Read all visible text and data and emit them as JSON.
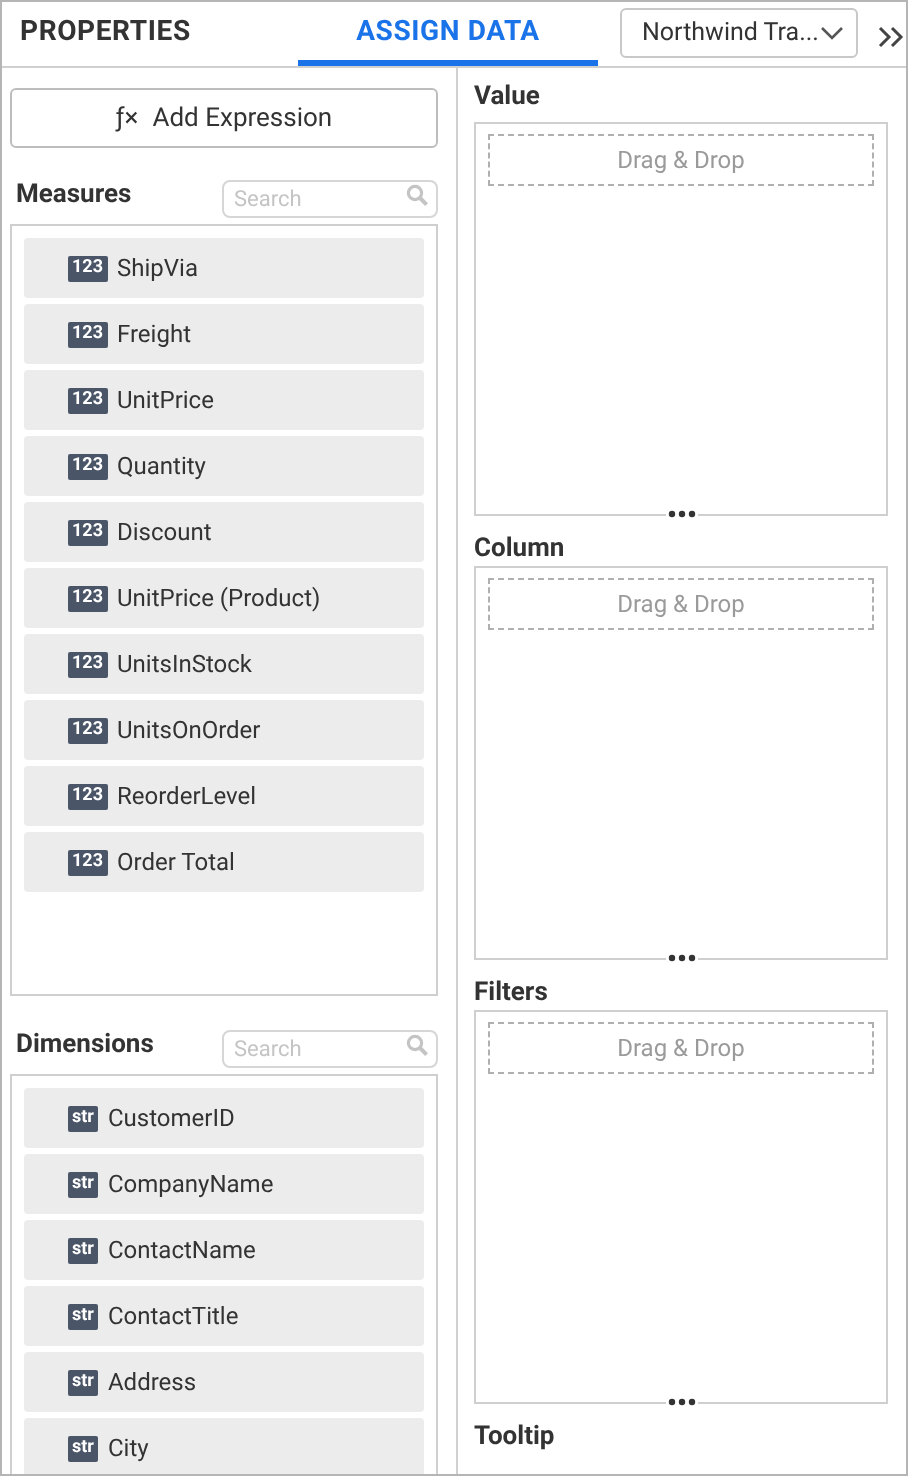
{
  "tabs": [
    {
      "label": "PROPERTIES",
      "selected": false
    },
    {
      "label": "ASSIGN DATA",
      "selected": true
    }
  ],
  "datasource": {
    "value": "Northwind Tra..."
  },
  "add_expression": {
    "icon": "ƒ×",
    "label": "Add Expression"
  },
  "sections": [
    {
      "title": "Measures",
      "search": {
        "placeholder": "Search"
      },
      "items": [
        {
          "type": "123",
          "label": "ShipVia"
        },
        {
          "type": "123",
          "label": "Freight"
        },
        {
          "type": "123",
          "label": "UnitPrice"
        },
        {
          "type": "123",
          "label": "Quantity"
        },
        {
          "type": "123",
          "label": "Discount"
        },
        {
          "type": "123",
          "label": "UnitPrice (Product)"
        },
        {
          "type": "123",
          "label": "UnitsInStock"
        },
        {
          "type": "123",
          "label": "UnitsOnOrder"
        },
        {
          "type": "123",
          "label": "ReorderLevel"
        },
        {
          "type": "123",
          "label": "Order Total"
        }
      ]
    },
    {
      "title": "Dimensions",
      "search": {
        "placeholder": "Search"
      },
      "items": [
        {
          "type": "str",
          "label": "CustomerID"
        },
        {
          "type": "str",
          "label": "CompanyName"
        },
        {
          "type": "str",
          "label": "ContactName"
        },
        {
          "type": "str",
          "label": "ContactTitle"
        },
        {
          "type": "str",
          "label": "Address"
        },
        {
          "type": "str",
          "label": "City"
        }
      ]
    }
  ],
  "drop_zones": [
    {
      "title": "Value",
      "hint": "Drag & Drop"
    },
    {
      "title": "Column",
      "hint": "Drag & Drop"
    },
    {
      "title": "Filters",
      "hint": "Drag & Drop"
    },
    {
      "title": "Tooltip"
    }
  ]
}
